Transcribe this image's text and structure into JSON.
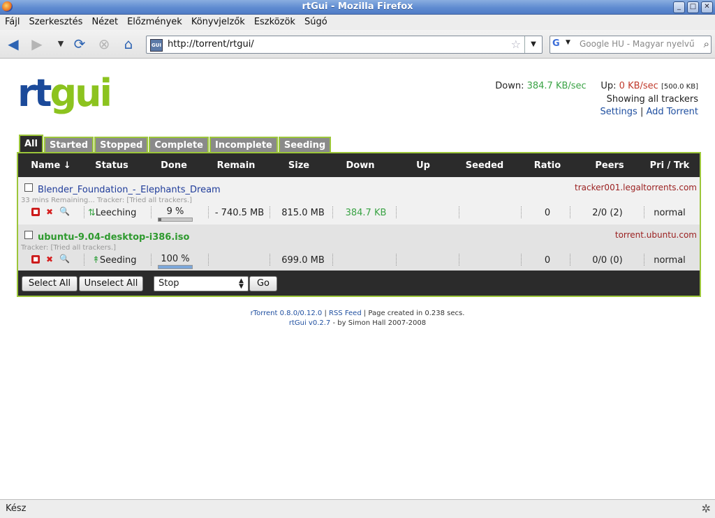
{
  "window": {
    "title": "rtGui - Mozilla Firefox",
    "min": "_",
    "max": "□",
    "close": "✕"
  },
  "menu": [
    "Fájl",
    "Szerkesztés",
    "Nézet",
    "Előzmények",
    "Könyvjelzők",
    "Eszközök",
    "Súgó"
  ],
  "nav": {
    "url": "http://torrent/rtgui/",
    "search_placeholder": "Google HU - Magyar nyelvű",
    "favicon_text": "GUI"
  },
  "logo": {
    "rt": "rt",
    "gui": "gui"
  },
  "stats": {
    "down_label": "Down:",
    "down_value": "384.7 KB/sec",
    "up_label": "Up:",
    "up_value": "0 KB/sec",
    "up_limit": "[500.0 KB]",
    "tracker_filter": "Showing all trackers",
    "settings": "Settings",
    "divider": "|",
    "add_torrent": "Add Torrent"
  },
  "tabs": [
    "All",
    "Started",
    "Stopped",
    "Complete",
    "Incomplete",
    "Seeding"
  ],
  "columns": [
    "Name ↓",
    "Status",
    "Done",
    "Remain",
    "Size",
    "Down",
    "Up",
    "Seeded",
    "Ratio",
    "Peers",
    "Pri / Trk"
  ],
  "torrents": [
    {
      "name": "Blender_Foundation_-_Elephants_Dream",
      "tracker": "tracker001.legaltorrents.com",
      "sub": "33 mins Remaining... Tracker: [Tried all trackers.]",
      "status_icon": "⇅",
      "status": "Leeching",
      "done": "9 %",
      "done_fraction": 0.09,
      "remain": "- 740.5 MB",
      "size": "815.0 MB",
      "down": "384.7 KB",
      "up": "",
      "seeded": "",
      "ratio": "0",
      "peers": "2/0 (2)",
      "priority": "normal"
    },
    {
      "name": "ubuntu-9.04-desktop-i386.iso",
      "tracker": "torrent.ubuntu.com",
      "sub": "Tracker: [Tried all trackers.]",
      "status_icon": "↟",
      "status": "Seeding",
      "done": "100 %",
      "done_fraction": 1.0,
      "remain": "",
      "size": "699.0 MB",
      "down": "",
      "up": "",
      "seeded": "",
      "ratio": "0",
      "peers": "0/0 (0)",
      "priority": "normal"
    }
  ],
  "actions": {
    "select_all": "Select All",
    "unselect_all": "Unselect All",
    "action_value": "Stop",
    "go": "Go"
  },
  "footer": {
    "rtorrent_version": "rTorrent 0.8.0/0.12.0",
    "sep": "|",
    "rss": "RSS Feed",
    "page_created": "| Page created in 0.238 secs.",
    "rtgui_version": "rtGui v0.2.7",
    "credit": "- by Simon Hall 2007-2008"
  },
  "status_bar": {
    "text": "Kész"
  }
}
